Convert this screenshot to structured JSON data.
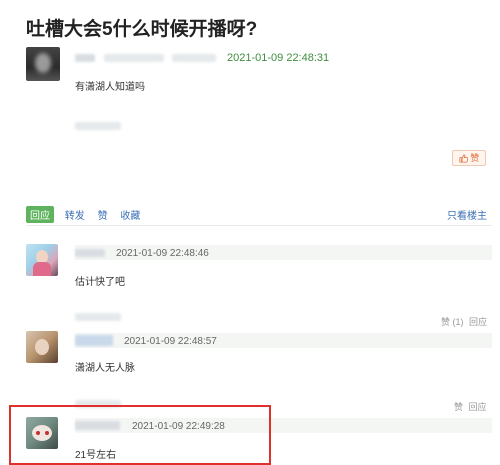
{
  "post": {
    "title": "吐槽大会5什么时候开播呀?",
    "timestamp": "2021-01-09 22:48:31",
    "body": "有潇湖人知道吗",
    "like_label": "赞"
  },
  "actions": {
    "reply": "回应",
    "repost": "转发",
    "like": "赞",
    "collect": "收藏",
    "author_only": "只看楼主"
  },
  "comments": [
    {
      "timestamp": "2021-01-09 22:48:46",
      "body": "估计快了吧",
      "like_count": "赞 (1)",
      "reply_label": "回应"
    },
    {
      "timestamp": "2021-01-09 22:48:57",
      "body": "潇湖人无人脉",
      "like_count": "赞",
      "reply_label": "回应"
    },
    {
      "timestamp": "2021-01-09 22:49:28",
      "body": "21号左右"
    }
  ],
  "colors": {
    "accent_green": "#5fb35f",
    "link_blue": "#3a6fb5",
    "highlight_red": "#e0302d"
  }
}
